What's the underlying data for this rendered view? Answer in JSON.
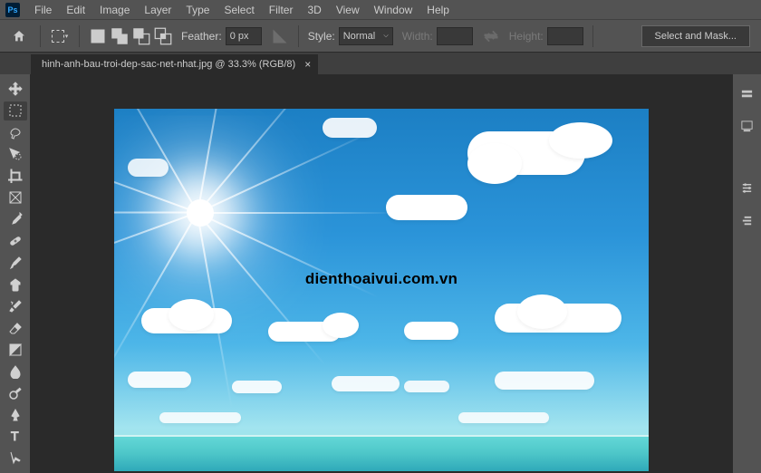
{
  "menu": {
    "items": [
      "File",
      "Edit",
      "Image",
      "Layer",
      "Type",
      "Select",
      "Filter",
      "3D",
      "View",
      "Window",
      "Help"
    ]
  },
  "options": {
    "feather_label": "Feather:",
    "feather_value": "0 px",
    "style_label": "Style:",
    "style_value": "Normal",
    "width_label": "Width:",
    "height_label": "Height:",
    "select_mask": "Select and Mask..."
  },
  "tab": {
    "title": "hinh-anh-bau-troi-dep-sac-net-nhat.jpg @ 33.3% (RGB/8)"
  },
  "canvas": {
    "watermark": "dienthoaivui.com.vn"
  }
}
